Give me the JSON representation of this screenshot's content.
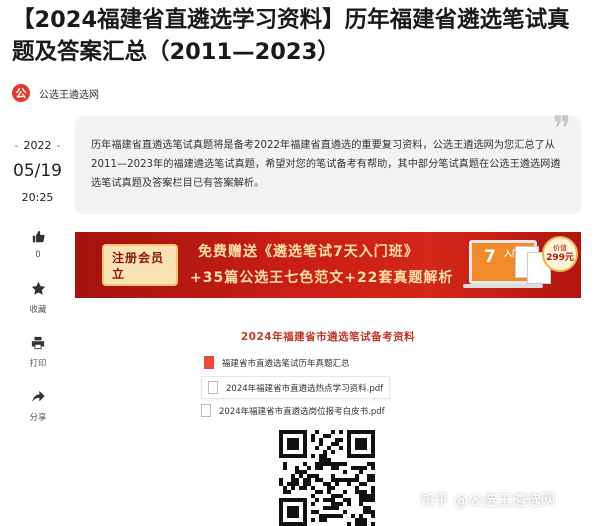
{
  "article": {
    "title": "【2024福建省直遴选学习资料】历年福建省遴选笔试真题及答案汇总（2011—2023）",
    "author": "公选王遴选网",
    "author_logo_glyph": "公",
    "date": {
      "year": "2022",
      "month_day": "05/19",
      "time": "20:25"
    },
    "intro": "历年福建省直遴选笔试真题将是备考2022年福建省直遴选的重要复习资料，公选王遴选网为您汇总了从2011—2023年的福建遴选笔试真题，希望对您的笔试备考有帮助，其中部分笔试真题在公选王遴选网遴选笔试真题及答案栏目已有答案解析。"
  },
  "actions": {
    "like": {
      "icon": "thumbs-up-icon",
      "count": "0"
    },
    "favorite": {
      "icon": "star-icon",
      "label": "收藏"
    },
    "print": {
      "icon": "printer-icon",
      "label": "打印"
    },
    "share": {
      "icon": "share-icon",
      "label": "分享"
    }
  },
  "banner": {
    "register_label": "注册会员立",
    "line1": "免费赠送《遴选笔试7天入门班》",
    "line2": "+35篇公选王七色范文+22套真题解析",
    "screen_big": "7",
    "screen_small": "入门班",
    "badge_top": "价值",
    "badge_price": "299元",
    "colors": {
      "bg": "#c71d15",
      "text": "#ffe1a3"
    }
  },
  "section": {
    "heading": "2024年福建省市遴选笔试备考资料",
    "files": [
      {
        "name": "福建省市直遴选笔试历年真题汇总",
        "icon": "folder-icon"
      },
      {
        "name": "2024年福建省市直遴选热点学习资料.pdf",
        "icon": "pdf-file-icon"
      },
      {
        "name": "2024年福建省市直遴选岗位报考白皮书.pdf",
        "icon": "pdf-file-icon"
      }
    ]
  },
  "watermark": "知乎 @公选王遴选网"
}
